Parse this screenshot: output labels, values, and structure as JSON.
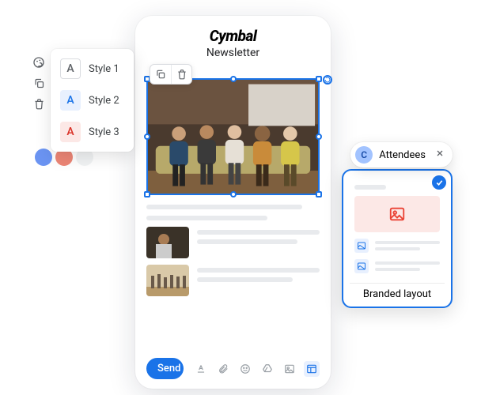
{
  "stylePicker": {
    "items": [
      {
        "glyph": "A",
        "label": "Style 1"
      },
      {
        "glyph": "A",
        "label": "Style 2"
      },
      {
        "glyph": "A",
        "label": "Style 3"
      }
    ]
  },
  "paletteDots": [
    "#6b94f2",
    "#ed8676",
    "#f1f3f4"
  ],
  "editor": {
    "brand": "Cymbal",
    "subtitle": "Newsletter",
    "sendLabel": "Send"
  },
  "tag": {
    "avatarLetter": "C",
    "label": "Attendees"
  },
  "layoutCard": {
    "label": "Branded layout"
  }
}
